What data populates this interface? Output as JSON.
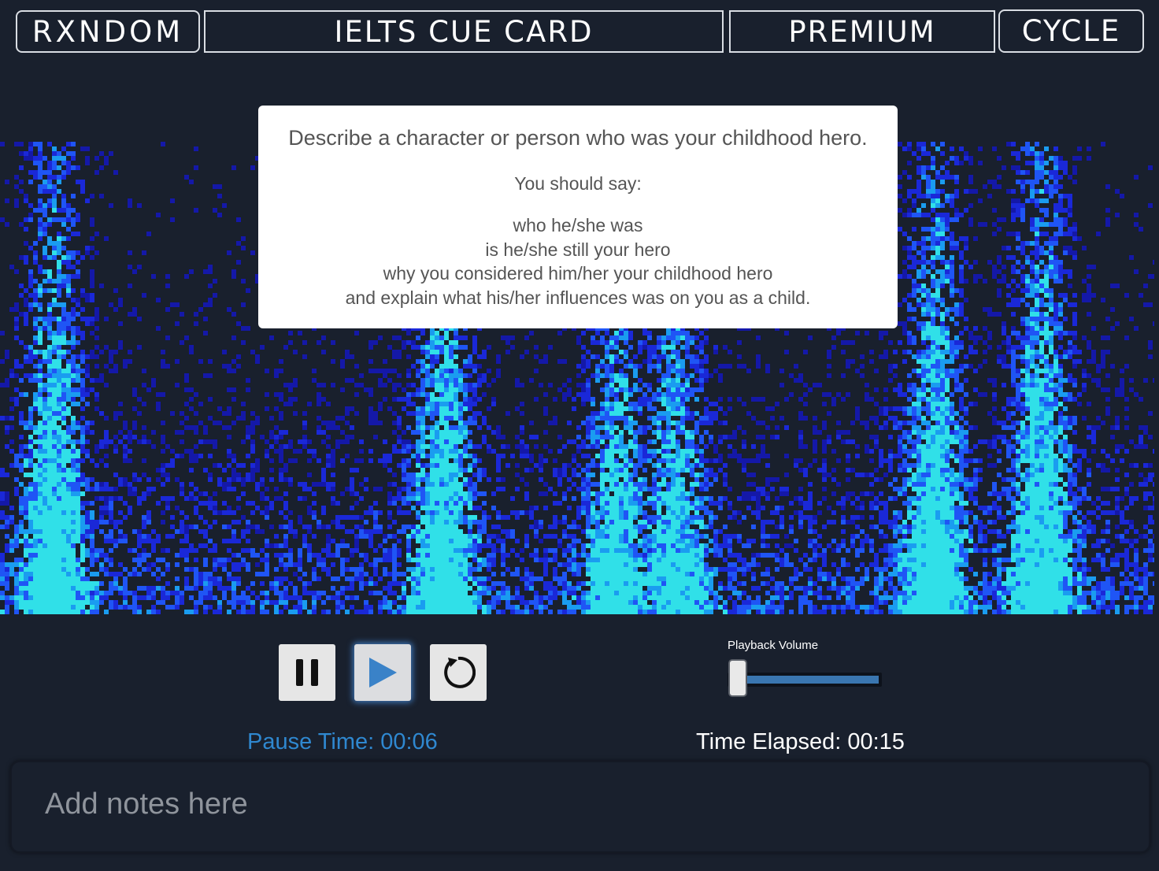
{
  "nav": {
    "logo": "RXNDOM",
    "title": "IELTS CUE CARD",
    "premium": "PREMIUM",
    "cycle": "CYCLE"
  },
  "cue_card": {
    "title": "Describe a character or person who was your childhood hero.",
    "prompt": "You should say:",
    "points": [
      "who he/she was",
      "is he/she still your hero",
      "why you considered him/her your childhood hero",
      "and explain what his/her influences was on you as a child."
    ]
  },
  "controls": {
    "pause_icon": "pause-icon",
    "play_icon": "play-icon",
    "restart_icon": "restart-icon",
    "play_color": "#3a82c8"
  },
  "volume": {
    "label": "Playback Volume",
    "level": 0.0
  },
  "timers": {
    "pause_time": "Pause Time: 00:06",
    "elapsed": "Time Elapsed: 00:15"
  },
  "notes": {
    "placeholder": "Add notes here",
    "value": ""
  },
  "colors": {
    "background": "#19202d",
    "accent": "#2f88d0"
  }
}
